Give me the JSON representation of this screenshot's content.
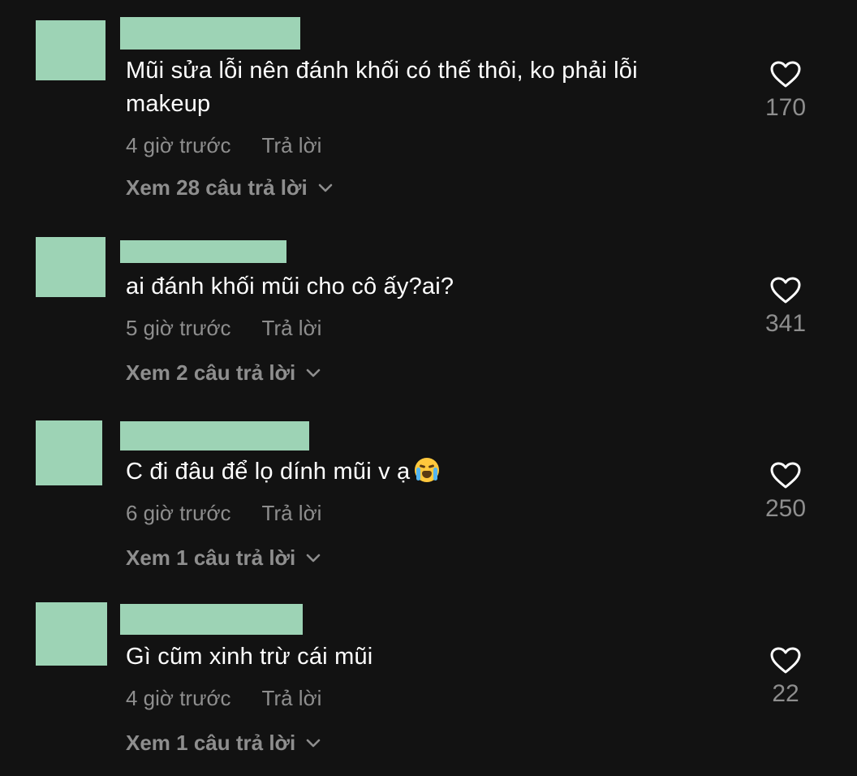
{
  "comments": [
    {
      "text": "Mũi sửa lỗi nên đánh khối có thế thôi, ko phải lỗi makeup",
      "time": "4 giờ trước",
      "reply_label": "Trả lời",
      "view_replies": "Xem 28 câu trả lời",
      "likes": "170",
      "emoji_icon": ""
    },
    {
      "text": "ai đánh khối mũi cho cô ấy?ai?",
      "time": "5 giờ trước",
      "reply_label": "Trả lời",
      "view_replies": "Xem 2 câu trả lời",
      "likes": "341",
      "emoji_icon": ""
    },
    {
      "text": "C đi đâu để lọ dính mũi v ạ",
      "time": "6 giờ trước",
      "reply_label": "Trả lời",
      "view_replies": "Xem 1 câu trả lời",
      "likes": "250",
      "emoji_icon": "loudly-crying-face-icon"
    },
    {
      "text": "Gì cũm xinh trừ cái mũi",
      "time": "4 giờ trước",
      "reply_label": "Trả lời",
      "view_replies": "Xem 1 câu trả lời",
      "likes": "22",
      "emoji_icon": ""
    }
  ],
  "colors": {
    "background": "#121212",
    "redaction": "#9dd3b5",
    "muted_text": "#8e8e8e",
    "primary_text": "#ffffff"
  }
}
